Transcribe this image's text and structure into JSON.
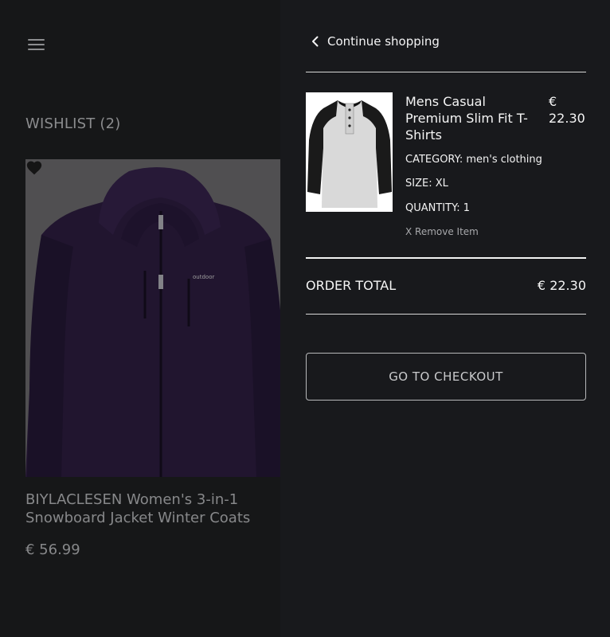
{
  "wishlist": {
    "title": "WISHLIST (2)",
    "product": {
      "name": "BIYLACLESEN Women's 3-in-1 Snowboard Jacket Winter Coats",
      "price": "€ 56.99",
      "image_label": "outdoor"
    }
  },
  "cart": {
    "continue_label": "Continue shopping",
    "item": {
      "name": "Mens Casual Premium Slim Fit T-Shirts",
      "price": "€ 22.30",
      "category": "CATEGORY: men's clothing",
      "size": "SIZE: XL",
      "quantity": "QUANTITY: 1",
      "remove_label": "X Remove Item"
    },
    "total_label": "ORDER TOTAL",
    "total_value": "€ 22.30",
    "checkout_label": "GO TO CHECKOUT"
  },
  "colors": {
    "drawer_bg": "#18191c",
    "page_bg": "#161718",
    "text_primary": "#f5f5f5",
    "jacket": "#2a1a3d"
  }
}
